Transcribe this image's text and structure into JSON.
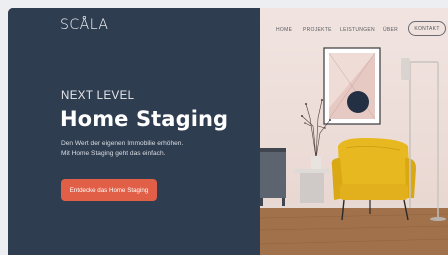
{
  "brand": {
    "logo": "SCÅLA"
  },
  "nav": {
    "items": [
      "HOME",
      "PROJEKTE",
      "LEISTUNGEN",
      "ÜBER"
    ],
    "contact": "KONTAKT"
  },
  "hero": {
    "eyebrow": "NEXT LEVEL",
    "headline": "Home Staging",
    "subline_1": "Den Wert der eigenen Immobilie erhöhen.",
    "subline_2": "Mit Home Staging geht das einfach.",
    "cta": "Entdecke das Home Staging"
  },
  "colors": {
    "panel": "#2f3d50",
    "accent": "#e05f46",
    "wall": "#ecdcd7",
    "chair": "#e8b820"
  }
}
